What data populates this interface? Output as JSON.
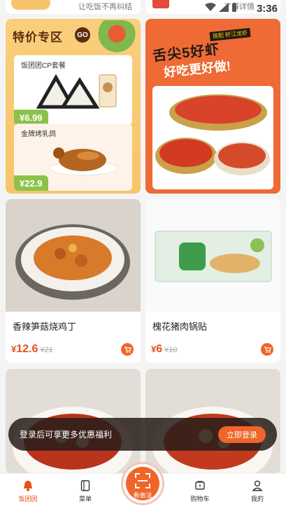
{
  "status_bar": {
    "time": "3:36"
  },
  "top_strip": {
    "left_text": "让吃饭不再纠结",
    "right_text": "了解详情"
  },
  "promo_left": {
    "title": "特价专区",
    "go_label": "GO",
    "items": [
      {
        "name": "饭团团CP套餐",
        "price": "¥6.99"
      },
      {
        "name": "金牌烤乳鸽",
        "price": "¥22.9"
      }
    ]
  },
  "promo_right": {
    "tag": "搭配 盱江龙虾",
    "line1": "舌尖5好虾",
    "line2": "好吃更好做!"
  },
  "products": [
    {
      "name": "香辣笋菇烧鸡丁",
      "currency": "¥",
      "price": "12.6",
      "original_price": "¥21"
    },
    {
      "name": "槐花猪肉锅贴",
      "currency": "¥",
      "price": "6",
      "original_price": "¥10"
    }
  ],
  "login_banner": {
    "text": "登录后可享更多优惠福利",
    "button": "立即登录"
  },
  "bottom_nav": {
    "items": [
      {
        "label": "饭团团"
      },
      {
        "label": "菜单"
      },
      {
        "label": "购物车"
      },
      {
        "label": "我的"
      }
    ],
    "scan_label": "看做法"
  },
  "colors": {
    "accent": "#f06529",
    "price": "#e84f1d",
    "promo_yellow": "#f9cf7c",
    "promo_orange": "#ef6a34",
    "tag_green": "#8bc34a"
  }
}
